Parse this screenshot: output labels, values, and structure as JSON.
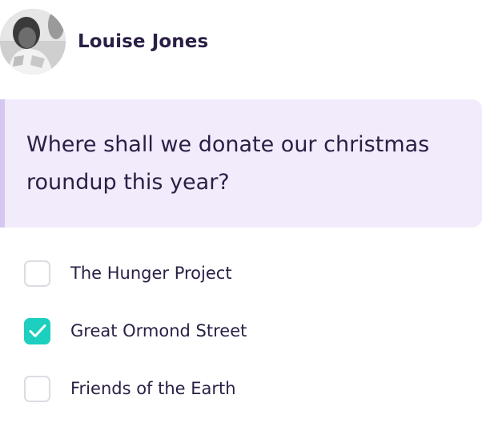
{
  "author": {
    "name": "Louise Jones",
    "avatar_icon": "user-photo-avatar"
  },
  "question": {
    "text": "Where shall we donate our christmas roundup this year?"
  },
  "options": [
    {
      "label": "The Hunger Project",
      "checked": false
    },
    {
      "label": "Great Ormond Street",
      "checked": true
    },
    {
      "label": "Friends of the Earth",
      "checked": false
    }
  ],
  "colors": {
    "text": "#2a1f45",
    "question_background": "#f1ebfb",
    "question_accent": "#d6c6f2",
    "checkbox_checked": "#1dcfbf",
    "checkbox_border": "#dddbe3"
  }
}
